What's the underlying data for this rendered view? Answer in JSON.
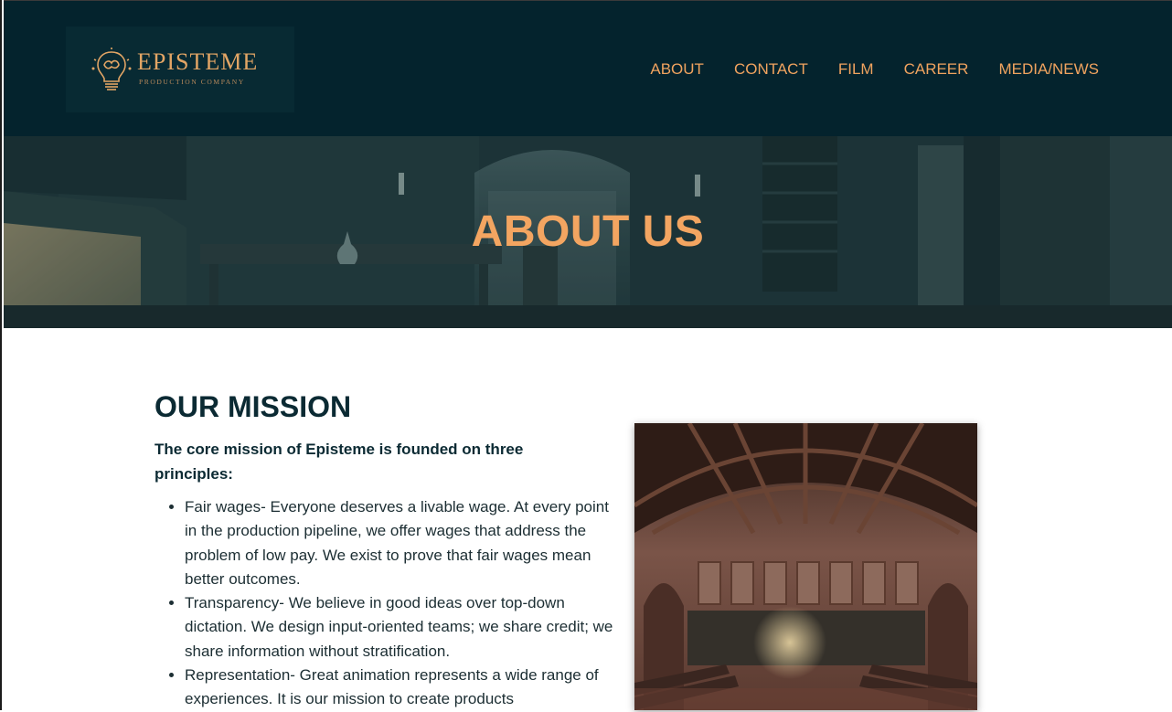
{
  "brand": {
    "name": "EPISTEME",
    "tagline": "PRODUCTION COMPANY",
    "accent_color": "#f0a35f",
    "header_bg": "#04232d",
    "logo_icon": "lightbulb-brain-icon"
  },
  "nav": {
    "items": [
      {
        "label": "ABOUT"
      },
      {
        "label": "CONTACT"
      },
      {
        "label": "FILM"
      },
      {
        "label": "CAREER"
      },
      {
        "label": "MEDIA/NEWS"
      }
    ]
  },
  "hero": {
    "title": "ABOUT US",
    "background": "library-room-illustration"
  },
  "mission": {
    "title": "OUR MISSION",
    "lead": "The core mission of Episteme is founded on three principles:",
    "items": [
      "Fair wages- Everyone deserves a livable wage. At every point in the production pipeline, we offer wages that address the problem of low pay. We exist to prove that fair wages mean better outcomes.",
      "Transparency- We believe in good ideas over top-down dictation. We design input-oriented teams; we share credit; we share information without stratification.",
      "Representation- Great animation represents a wide range of experiences. It is our mission to create products"
    ],
    "image": "vaulted-hall-illustration"
  }
}
